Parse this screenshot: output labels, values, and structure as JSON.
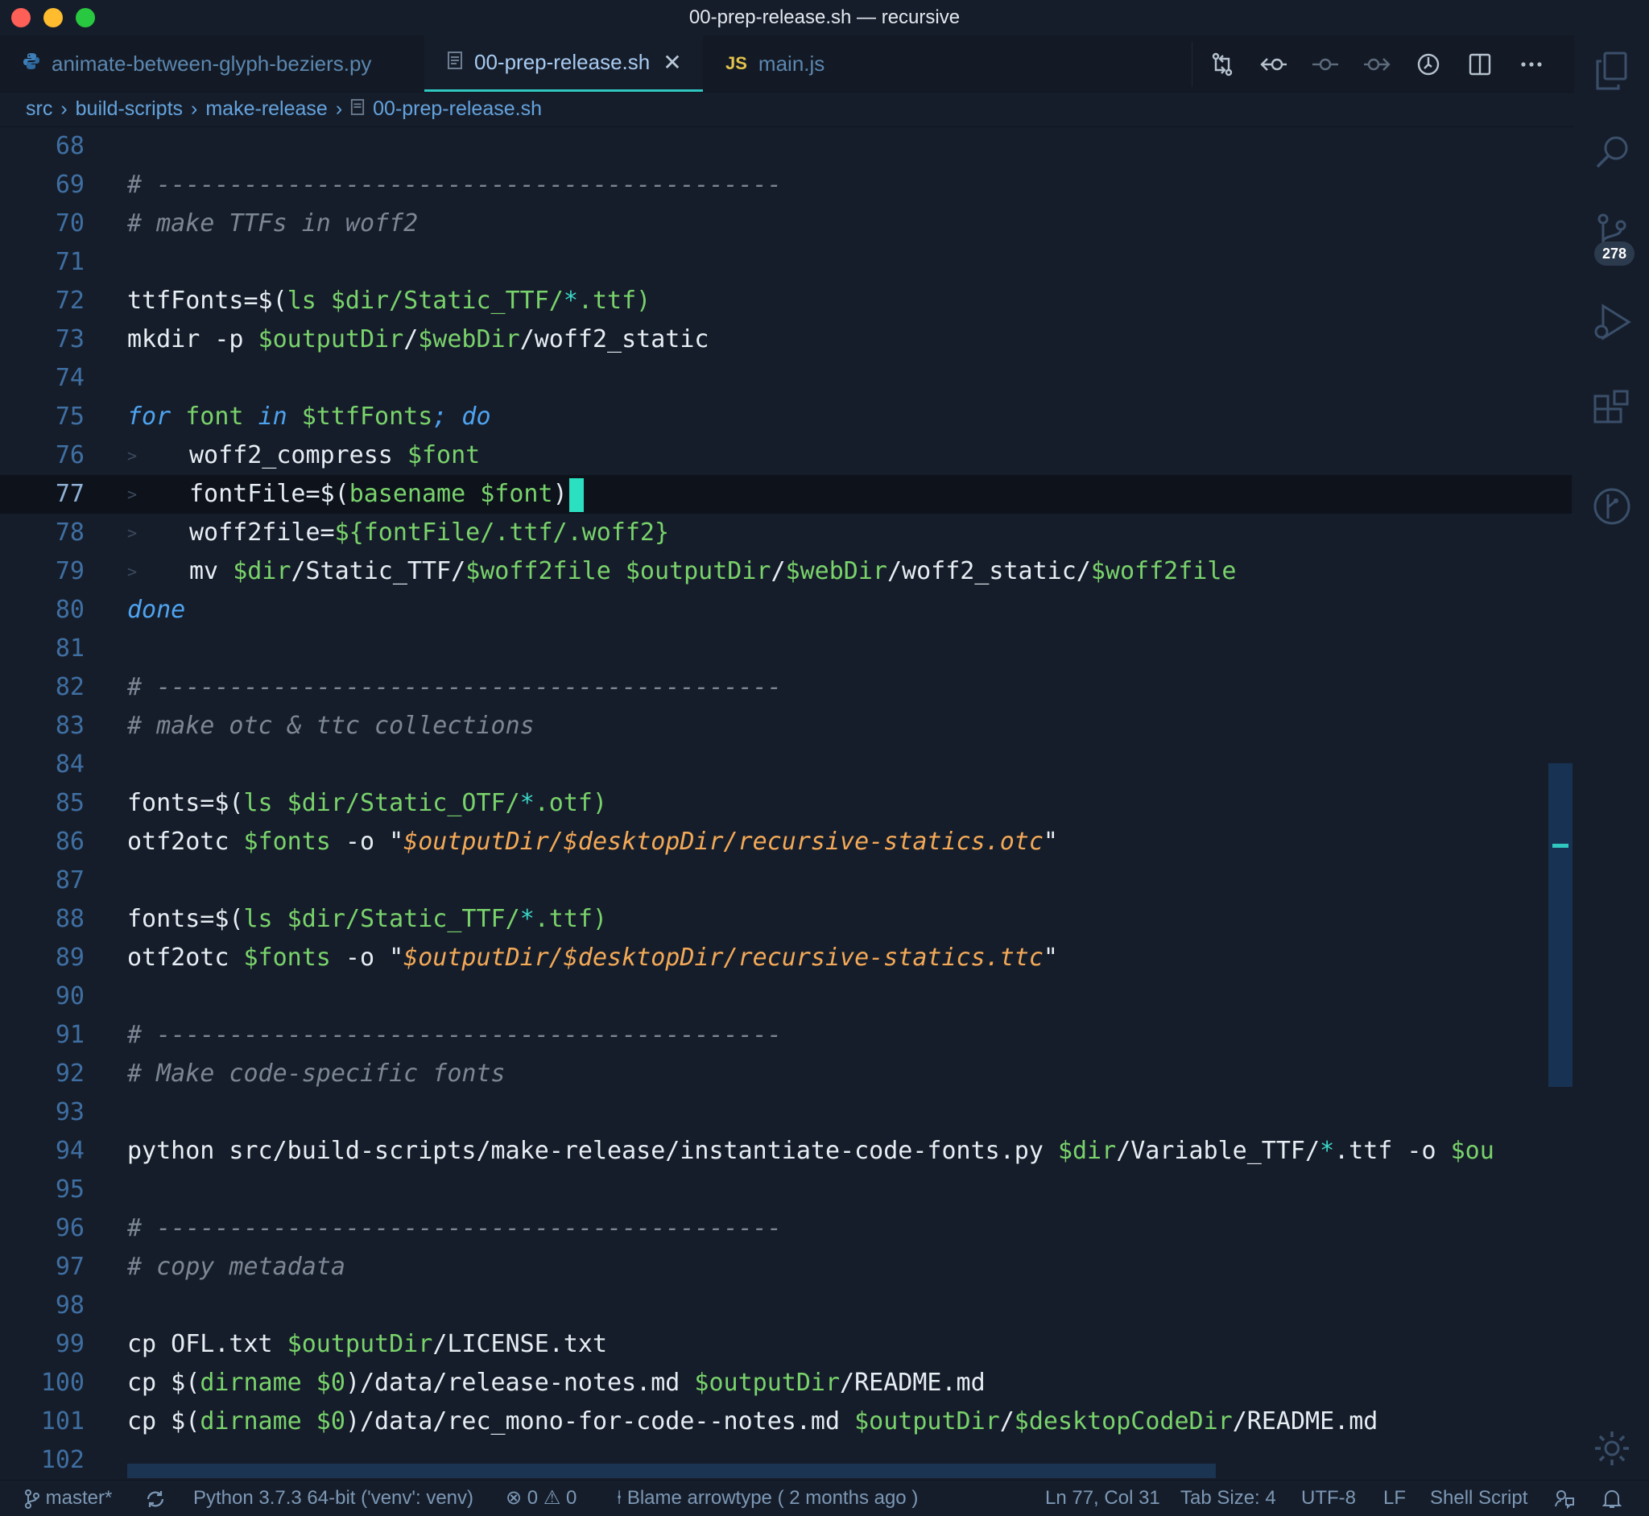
{
  "window": {
    "title": "00-prep-release.sh — recursive"
  },
  "tabs": [
    {
      "label": "animate-between-glyph-beziers.py",
      "icon": "python-icon"
    },
    {
      "label": "00-prep-release.sh",
      "icon": "document-icon",
      "close": "✕"
    },
    {
      "label": "main.js",
      "icon": "js-icon",
      "icon_text": "JS"
    }
  ],
  "breadcrumb": [
    "src",
    "build-scripts",
    "make-release",
    "00-prep-release.sh"
  ],
  "activity": {
    "source_control_badge": "278"
  },
  "editor": {
    "cursor_line": 77,
    "lines": [
      {
        "n": "68"
      },
      {
        "n": "69"
      },
      {
        "n": "70"
      },
      {
        "n": "71"
      },
      {
        "n": "72"
      },
      {
        "n": "73"
      },
      {
        "n": "74"
      },
      {
        "n": "75"
      },
      {
        "n": "76"
      },
      {
        "n": "77"
      },
      {
        "n": "78"
      },
      {
        "n": "79"
      },
      {
        "n": "80"
      },
      {
        "n": "81"
      },
      {
        "n": "82"
      },
      {
        "n": "83"
      },
      {
        "n": "84"
      },
      {
        "n": "85"
      },
      {
        "n": "86"
      },
      {
        "n": "87"
      },
      {
        "n": "88"
      },
      {
        "n": "89"
      },
      {
        "n": "90"
      },
      {
        "n": "91"
      },
      {
        "n": "92"
      },
      {
        "n": "93"
      },
      {
        "n": "94"
      },
      {
        "n": "95"
      },
      {
        "n": "96"
      },
      {
        "n": "97"
      },
      {
        "n": "98"
      },
      {
        "n": "99"
      },
      {
        "n": "100"
      },
      {
        "n": "101"
      },
      {
        "n": "102"
      }
    ],
    "text": {
      "l69": "# -------------------------------------------",
      "l70": "# make TTFs in woff2",
      "l72a": "ttfFonts=$(",
      "l72b": "ls",
      "l72c": " $dir",
      "l72d": "/Static_TTF/",
      "l72e": "*",
      "l72f": ".ttf)",
      "l73a": "mkdir -p ",
      "l73b": "$outputDir",
      "l73c": "/",
      "l73d": "$webDir",
      "l73e": "/woff2_static",
      "l75a": "for",
      "l75b": " font ",
      "l75c": "in",
      "l75d": " $ttfFonts",
      "l75e": ";",
      "l75f": " do",
      "l76a": "woff2_compress ",
      "l76b": "$font",
      "l77a": "fontFile=$(",
      "l77b": "basename",
      "l77c": " $font",
      "l77d": ")",
      "l78a": "woff2file=",
      "l78b": "${fontFile/.ttf/.woff2}",
      "l79a": "mv ",
      "l79b": "$dir",
      "l79c": "/Static_TTF/",
      "l79d": "$woff2file",
      "l79e": " $outputDir",
      "l79f": "/",
      "l79g": "$webDir",
      "l79h": "/woff2_static/",
      "l79i": "$woff2file",
      "l80": "done",
      "l82": "# -------------------------------------------",
      "l83": "# make otc & ttc collections",
      "l85a": "fonts=$(",
      "l85b": "ls",
      "l85c": " $dir",
      "l85d": "/Static_OTF/",
      "l85e": "*",
      "l85f": ".otf)",
      "l86a": "otf2otc ",
      "l86b": "$fonts",
      "l86c": " -o \"",
      "l86d": "$outputDir/$desktopDir/recursive-statics.otc",
      "l86e": "\"",
      "l88a": "fonts=$(",
      "l88b": "ls",
      "l88c": " $dir",
      "l88d": "/Static_TTF/",
      "l88e": "*",
      "l88f": ".ttf)",
      "l89a": "otf2otc ",
      "l89b": "$fonts",
      "l89c": " -o \"",
      "l89d": "$outputDir/$desktopDir/recursive-statics.ttc",
      "l89e": "\"",
      "l91": "# -------------------------------------------",
      "l92": "# Make code-specific fonts",
      "l94a": "python src/build-scripts/make-release/instantiate-code-fonts.py ",
      "l94b": "$dir",
      "l94c": "/Variable_TTF/",
      "l94d": "*",
      "l94e": ".ttf -o ",
      "l94f": "$ou",
      "l96": "# -------------------------------------------",
      "l97": "# copy metadata",
      "l99a": "cp OFL.txt ",
      "l99b": "$outputDir",
      "l99c": "/LICENSE.txt",
      "l100a": "cp $(",
      "l100b": "dirname",
      "l100c": " $0",
      "l100d": ")/data/release-notes.md ",
      "l100e": "$outputDir",
      "l100f": "/README.md",
      "l101a": "cp $(",
      "l101b": "dirname",
      "l101c": " $0",
      "l101d": ")/data/rec_mono-for-code--notes.md ",
      "l101e": "$outputDir",
      "l101f": "/",
      "l101g": "$desktopCodeDir",
      "l101h": "/README.md"
    }
  },
  "statusbar": {
    "branch": "master*",
    "python": "Python 3.7.3 64-bit ('venv': venv)",
    "errors": "0",
    "warnings": "0",
    "blame": "Blame arrowtype ( 2 months ago )",
    "position": "Ln 77, Col 31",
    "tab_size": "Tab Size: 4",
    "encoding": "UTF-8",
    "eol": "LF",
    "language": "Shell Script"
  },
  "colors": {
    "background": "#161d2a",
    "keyword": "#4ea3f0",
    "variable": "#79d36b",
    "string": "#f3a957",
    "comment": "#7c8694",
    "cursor": "#2be0c0"
  }
}
